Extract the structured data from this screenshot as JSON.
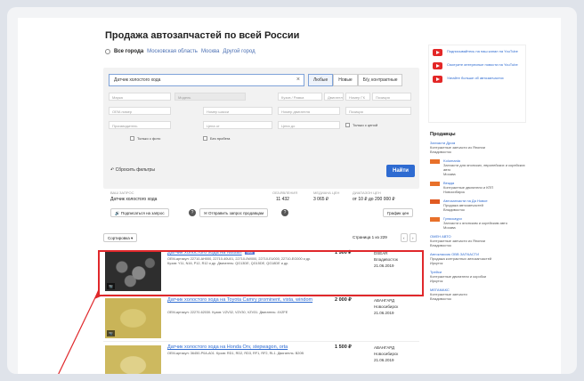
{
  "page": {
    "title": "Продажа автозапчастей по всей России",
    "cities": [
      "Все города",
      "Московская область",
      "Москва",
      "Другой город"
    ]
  },
  "search": {
    "query": "Датчик холостого хода",
    "condition_options": [
      "Любые",
      "Новые",
      "Б/у, контрактные"
    ],
    "condition_selected": "Любые"
  },
  "filters": {
    "row1": [
      "Марка",
      "Модель",
      "Кузов / Рамка",
      "Двигатель",
      "Номер ГК",
      "Позиция",
      "Расположение"
    ],
    "row2": [
      "OEM-номер",
      "Номер шасси",
      "Номер двигателя",
      "Позиция"
    ],
    "row3": [
      "Производитель",
      "Цена от",
      "Цена до",
      "Только с ценой"
    ],
    "checkboxes": [
      "Только с фото",
      "Без пробега"
    ],
    "reset_label": "Сбросить фильтры",
    "find_label": "Найти"
  },
  "stats": {
    "query_label": "ВАШ ЗАПРОС",
    "query_value": "Датчик холостого хода",
    "count_label": "ОБЪЯВЛЕНИЯ",
    "count_value": "11 432",
    "median_label": "МЕДИАНА ЦЕН",
    "median_value": "3 065 ₽",
    "range_label": "ДИАПАЗОН ЦЕН",
    "range_value": "от 10 ₽ до 200 000 ₽",
    "subscribe_label": "Подписаться на запрос",
    "send_request_label": "Отправить запрос продавцам",
    "price_chart_label": "График цен"
  },
  "sort": {
    "label": "Сортировка",
    "pagination": "Страница 1 из 229"
  },
  "items": [
    {
      "title": "Датчик холостого хода на Nissan",
      "badge": "new",
      "desc": "OEM-артикул: 22710-AH000, 22710-40U01, 22710-0W000, 22710-EU000, 22710-EG000 и др. Кузов: Y11, N16, P12, R12 и др. Двигатель: QG13DE, QG15DE, QG18DE и др.",
      "price": "1 500 ₽",
      "seller": "DSEAR",
      "city": "Владивосток",
      "date": "21.06.2019"
    },
    {
      "title": "Датчик холостого хода на Toyota Camry prominent, vista, windom",
      "badge": "",
      "desc": "OEM-артикул: 22270-62030. Кузов: VZV32, VZV30, VZV31. Двигатель: 4VZFE",
      "price": "2 000 ₽",
      "seller": "АВАНГАРД",
      "city": "Новосибирск",
      "date": "21.06.2019"
    },
    {
      "title": "Датчик холостого хода на Honda Orv, stepwagon, orta",
      "badge": "",
      "desc": "OEM-артикул: 36450-P0A-A01. Кузов: RD1, RD2, RD3, RF1, RF2, RL1. Двигатель: B20B",
      "price": "1 500 ₽",
      "seller": "АВАНГАРД",
      "city": "Новосибирск",
      "date": "21.06.2019"
    }
  ],
  "sidebar": {
    "promos": [
      "Подписывайтесь на наш канал на YouTube",
      "Смотрите интересные новости на YouTube",
      "Узнайте больше об автозапчастях"
    ],
    "sellers_heading": "Продавцы",
    "sellers": [
      {
        "name": "Запчасти Дром",
        "desc": "Контрактные запчасти из Японии",
        "city": "Владивосток"
      },
      {
        "name": "Kolumania",
        "desc": "Запчасти для японских, европейских и корейских авто",
        "city": "Москва"
      },
      {
        "name": "Вежда",
        "desc": "Контрактные двигатели и КПП",
        "city": "Новосибирск"
      },
      {
        "name": "Автозапчасти на Да Новое",
        "desc": "Продажа автозапчастей",
        "city": "Владивосток"
      },
      {
        "name": "Гуляскаури",
        "desc": "Запчасти к японским и корейским авто",
        "city": "Москва"
      },
      {
        "name": "ОМЕН АВТО",
        "desc": "Контрактные запчасти из Японии",
        "city": "Владивосток"
      },
      {
        "name": "Автоклассик ОВВ ЗАПЧАСТИ",
        "desc": "Продажа контрактных автозапчастей",
        "city": "Иркутск"
      },
      {
        "name": "Трейси",
        "desc": "Контрактные двигатели и коробки",
        "city": "Иркутск"
      },
      {
        "name": "МЕГАМАКС",
        "desc": "Контрактные запчасти",
        "city": "Владивосток"
      }
    ]
  },
  "colors": {
    "accent": "#2e6bd1",
    "highlight": "#e0282b",
    "youtube": "#e32727"
  }
}
